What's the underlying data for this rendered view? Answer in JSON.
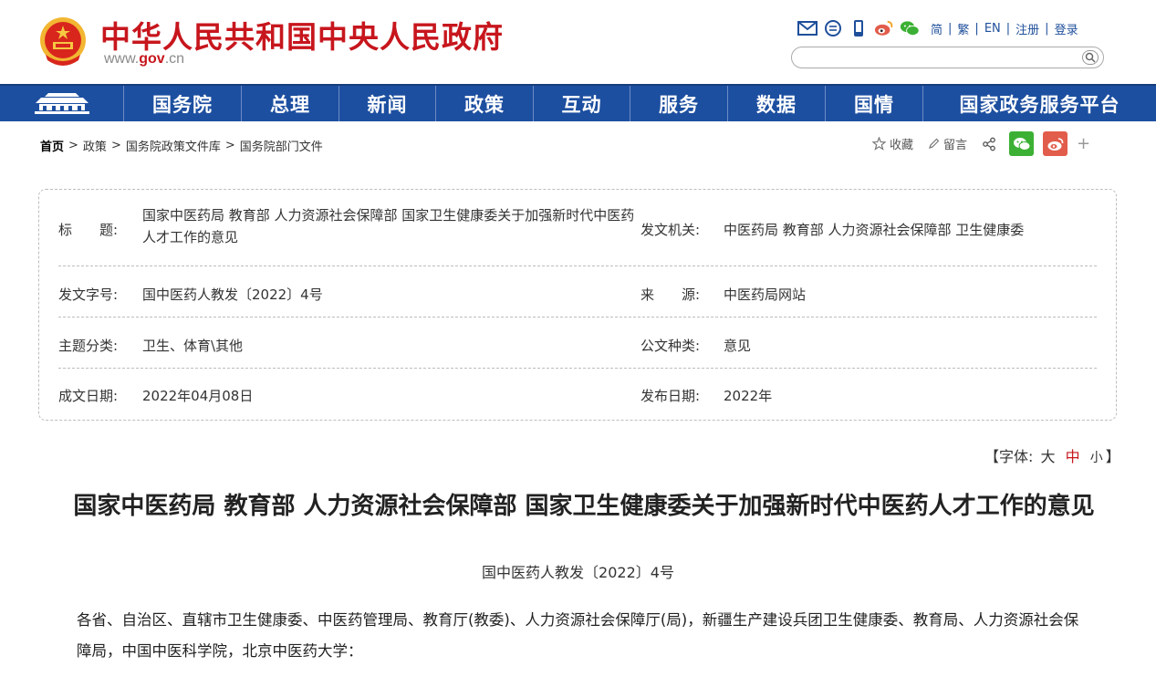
{
  "header": {
    "site_title": "中华人民共和国中央人民政府",
    "domain_prefix": "www.",
    "domain_main": "gov",
    "domain_suffix": ".cn",
    "lang_simplified": "简",
    "lang_traditional": "繁",
    "lang_english": "EN",
    "register": "注册",
    "login": "登录",
    "search_placeholder": ""
  },
  "nav": {
    "items": [
      "国务院",
      "总理",
      "新闻",
      "政策",
      "互动",
      "服务",
      "数据",
      "国情",
      "国家政务服务平台"
    ]
  },
  "breadcrumb": {
    "home": "首页",
    "items": [
      "政策",
      "国务院政策文件库",
      "国务院部门文件"
    ],
    "separator": ">"
  },
  "share": {
    "collect": "收藏",
    "comment": "留言",
    "plus": "+"
  },
  "info": {
    "title_label": "标　　题:",
    "title_value": "国家中医药局 教育部 人力资源社会保障部 国家卫生健康委关于加强新时代中医药人才工作的意见",
    "issuer_label": "发文机关:",
    "issuer_value": "中医药局 教育部 人力资源社会保障部 卫生健康委",
    "docno_label": "发文字号:",
    "docno_value": "国中医药人教发〔2022〕4号",
    "source_label": "来　　源:",
    "source_value": "中医药局网站",
    "category_label": "主题分类:",
    "category_value": "卫生、体育\\其他",
    "type_label": "公文种类:",
    "type_value": "意见",
    "written_label": "成文日期:",
    "written_value": "2022年04月08日",
    "published_label": "发布日期:",
    "published_value": "2022年"
  },
  "font_size": {
    "prefix": "【字体:",
    "large": "大",
    "medium": "中",
    "small": "小",
    "suffix": "】"
  },
  "article": {
    "title": "国家中医药局 教育部 人力资源社会保障部 国家卫生健康委关于加强新时代中医药人才工作的意见",
    "doc_number": "国中医药人教发〔2022〕4号",
    "body": "各省、自治区、直辖市卫生健康委、中医药管理局、教育厅(教委)、人力资源社会保障厅(局)，新疆生产建设兵团卫生健康委、教育局、人力资源社会保障局，中国中医科学院，北京中医药大学："
  },
  "colors": {
    "brand_red": "#c7161d",
    "nav_blue": "#1d4fa0",
    "link_blue": "#1f4f9b",
    "wechat_green": "#3cb034",
    "weibo_red": "#e25c4b"
  }
}
